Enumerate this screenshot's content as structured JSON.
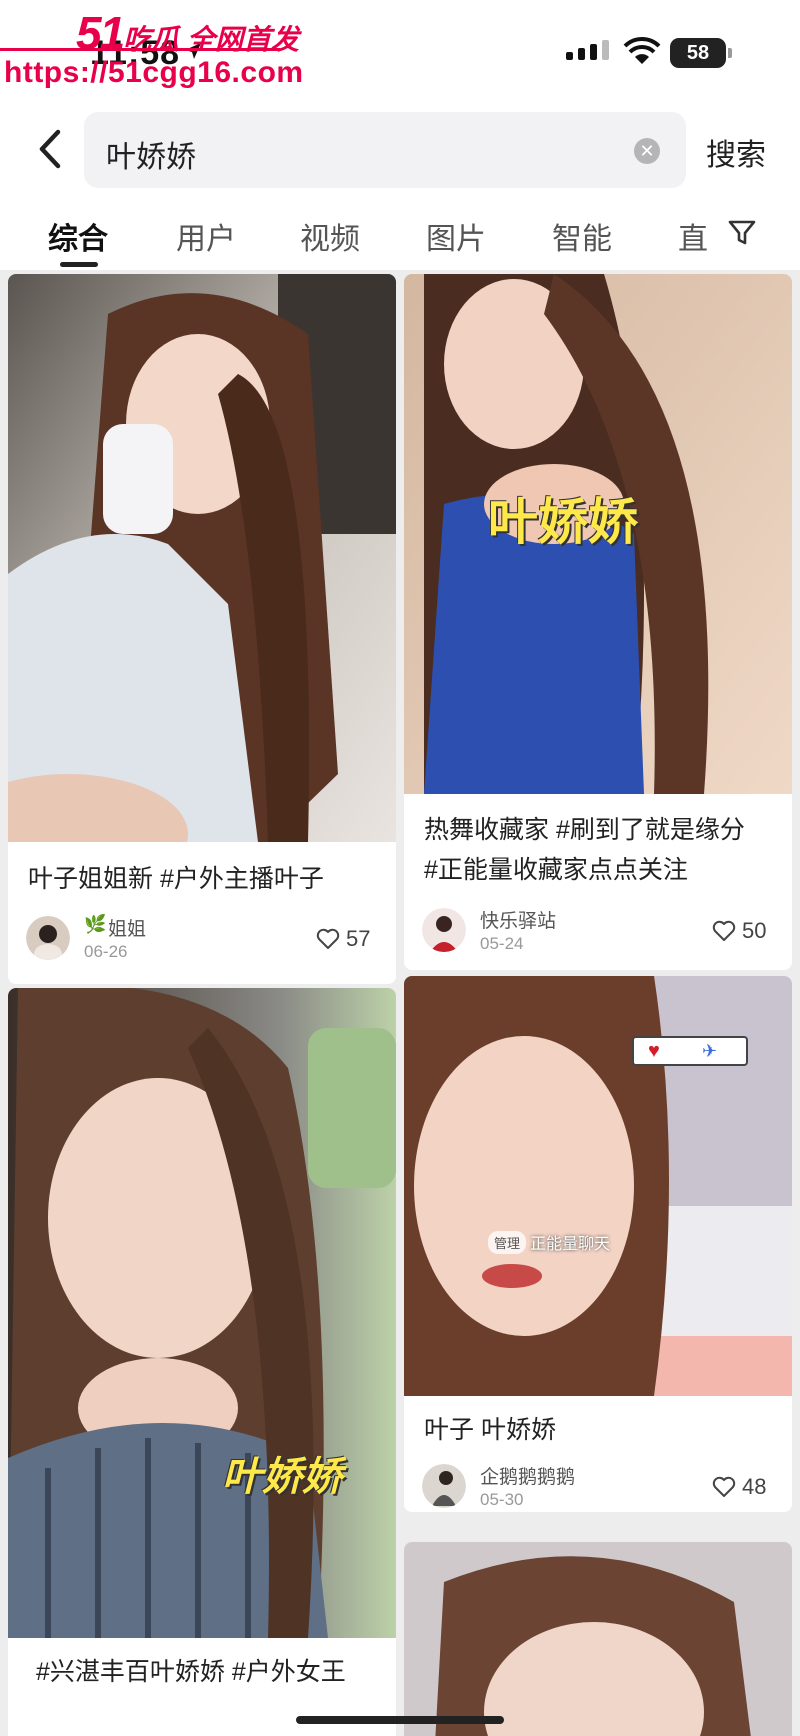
{
  "status_bar": {
    "time": "11:58",
    "battery": "58"
  },
  "watermark": {
    "brand_num": "51",
    "brand_text": "吃瓜 全网首发",
    "url": "https://51cgg16.com"
  },
  "search": {
    "query": "叶娇娇",
    "button_label": "搜索"
  },
  "tabs": [
    {
      "label": "综合",
      "active": true
    },
    {
      "label": "用户"
    },
    {
      "label": "视频"
    },
    {
      "label": "图片"
    },
    {
      "label": "智能"
    },
    {
      "label": "直"
    }
  ],
  "cards": [
    {
      "title_lines": [
        "叶子姐姐新 #户外主播叶子"
      ],
      "author": "姐姐",
      "date": "06-26",
      "likes": "57"
    },
    {
      "title_lines": [
        "热舞收藏家 #刷到了就是缘分",
        "#正能量收藏家点点关注"
      ],
      "author": "快乐驿站",
      "date": "05-24",
      "likes": "50",
      "overlay": "叶娇娇"
    },
    {
      "title_lines": [
        "#兴湛丰百叶娇娇 #户外女王"
      ],
      "overlay": "叶娇娇"
    },
    {
      "title_lines": [
        "叶子 叶娇娇"
      ],
      "author": "企鹅鹅鹅鹅",
      "date": "05-30",
      "likes": "48",
      "overlay_small": "正能量聊天",
      "overlay_badge": "管理"
    }
  ],
  "colors": {
    "watermark": "#e8004a",
    "overlay_text": "#ffe84a"
  }
}
